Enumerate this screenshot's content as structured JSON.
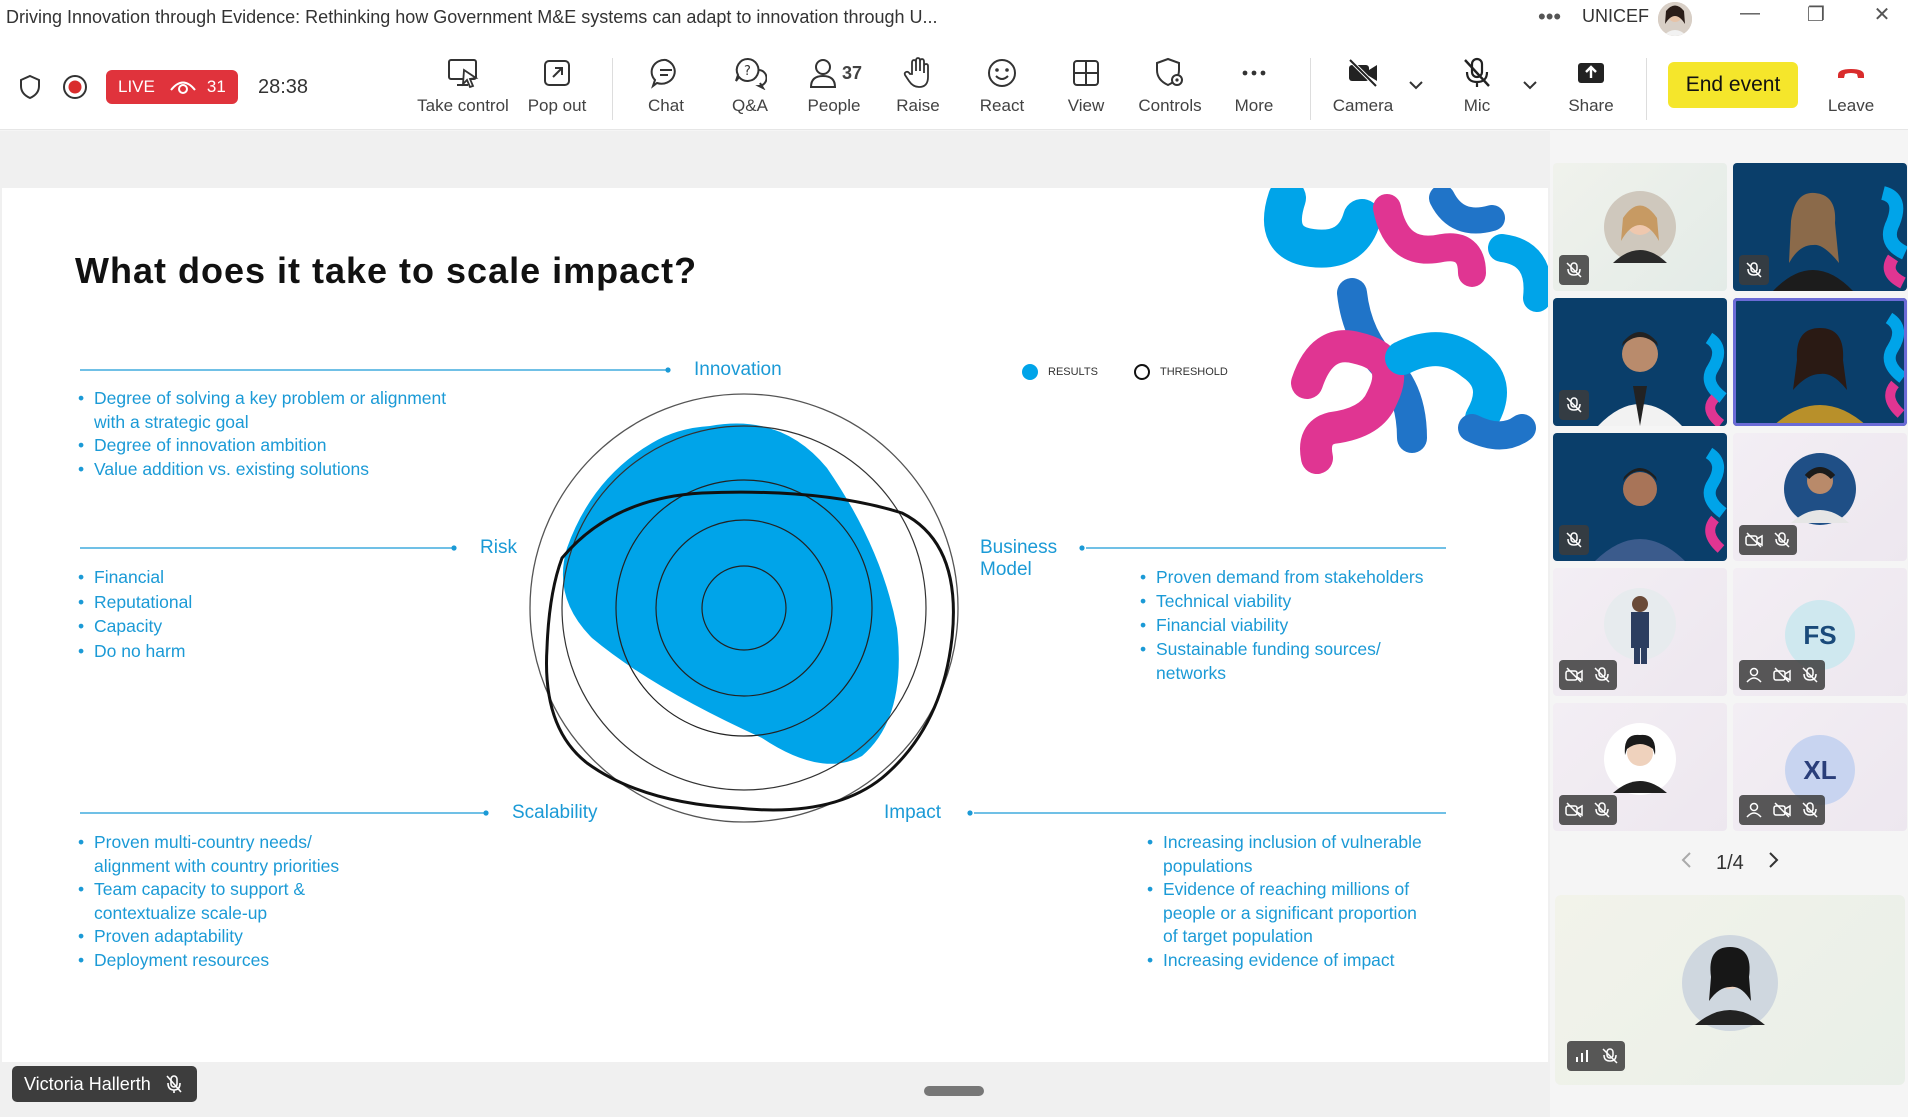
{
  "window": {
    "title": "Driving Innovation through Evidence: Rethinking how Government M&E systems can adapt to innovation through U...",
    "more": "•••",
    "org": "UNICEF",
    "minimize": "—",
    "restore": "❐",
    "close": "✕"
  },
  "status": {
    "live_label": "LIVE",
    "viewers": "31",
    "elapsed": "28:38"
  },
  "toolbar": {
    "take_control": "Take control",
    "pop_out": "Pop out",
    "chat": "Chat",
    "qa": "Q&A",
    "people": "People",
    "people_count": "37",
    "raise": "Raise",
    "react": "React",
    "view": "View",
    "controls": "Controls",
    "more": "More",
    "camera": "Camera",
    "mic": "Mic",
    "share": "Share",
    "end_event": "End event",
    "leave": "Leave"
  },
  "slide": {
    "title": "What does it take to scale impact?",
    "legend_results": "RESULTS",
    "legend_threshold": "THRESHOLD",
    "innovation": {
      "label": "Innovation",
      "items": [
        "Degree of solving a key problem or alignment",
        "with a strategic goal",
        "Degree of innovation ambition",
        "Value addition vs. existing solutions"
      ]
    },
    "risk": {
      "label": "Risk",
      "items": [
        "Financial",
        "Reputational",
        "Capacity",
        "Do no harm"
      ]
    },
    "business_model": {
      "label_line1": "Business",
      "label_line2": "Model",
      "items": [
        "Proven demand from stakeholders",
        "Technical viability",
        "Financial viability",
        "Sustainable funding sources/",
        "networks"
      ]
    },
    "scalability": {
      "label": "Scalability",
      "items": [
        "Proven multi-country needs/",
        "alignment with country priorities",
        "Team capacity to support &",
        "contextualize scale-up",
        "Proven adaptability",
        "Deployment resources"
      ]
    },
    "impact": {
      "label": "Impact",
      "items": [
        "Increasing inclusion of vulnerable",
        "populations",
        "Evidence of reaching millions of",
        "people or a significant proportion",
        "of target population",
        "Increasing evidence of impact"
      ]
    }
  },
  "presenter": {
    "name": "Victoria Hallerth"
  },
  "gallery": {
    "initials_fs": "FS",
    "initials_xl": "XL",
    "page": "1/4"
  },
  "colors": {
    "accent_blue": "#1b9ad6",
    "results_fill": "#00a4e9",
    "live_red": "#e0333c",
    "end_event_yellow": "#f5e62b",
    "leave_red": "#d92c2c",
    "brand_pink": "#e03592",
    "brand_navy": "#0a3e6a"
  }
}
